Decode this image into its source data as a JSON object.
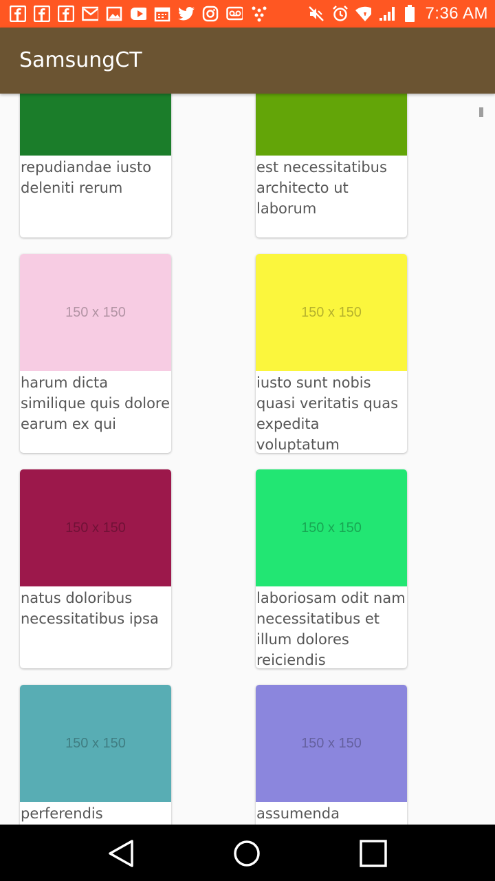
{
  "status_bar": {
    "time": "7:36 AM",
    "left_icons": [
      "facebook-icon",
      "facebook-icon",
      "facebook-icon",
      "gmail-icon",
      "gallery-icon",
      "youtube-icon",
      "calendar-icon",
      "twitter-icon",
      "instagram-icon",
      "voicemail-icon",
      "dots-icon"
    ],
    "right_icons": [
      "mute-icon",
      "alarm-icon",
      "wifi-icon",
      "signal-icon",
      "battery-icon"
    ]
  },
  "toolbar": {
    "title": "SamsungCT"
  },
  "cards": [
    {
      "color": "#1b7d2a",
      "placeholder": "",
      "caption": "repudiandae iusto deleniti rerum"
    },
    {
      "color": "#63a508",
      "placeholder": "",
      "caption": "est necessitatibus architecto ut laborum"
    },
    {
      "color": "#f7cce3",
      "placeholder": "150 x 150",
      "caption": "harum dicta similique quis dolore earum ex qui"
    },
    {
      "color": "#fbf63d",
      "placeholder": "150 x 150",
      "caption": "iusto sunt nobis quasi veritatis quas expedita voluptatum"
    },
    {
      "color": "#9c184b",
      "placeholder": "150 x 150",
      "caption": "natus doloribus necessitatibus ipsa"
    },
    {
      "color": "#22e673",
      "placeholder": "150 x 150",
      "caption": "laboriosam odit nam necessitatibus et illum dolores reiciendis"
    },
    {
      "color": "#58adb4",
      "placeholder": "150 x 150",
      "caption": "perferendis"
    },
    {
      "color": "#8b86dd",
      "placeholder": "150 x 150",
      "caption": "assumenda"
    }
  ],
  "nav_bar": {
    "buttons": [
      "back-icon",
      "home-icon",
      "recents-icon"
    ]
  }
}
